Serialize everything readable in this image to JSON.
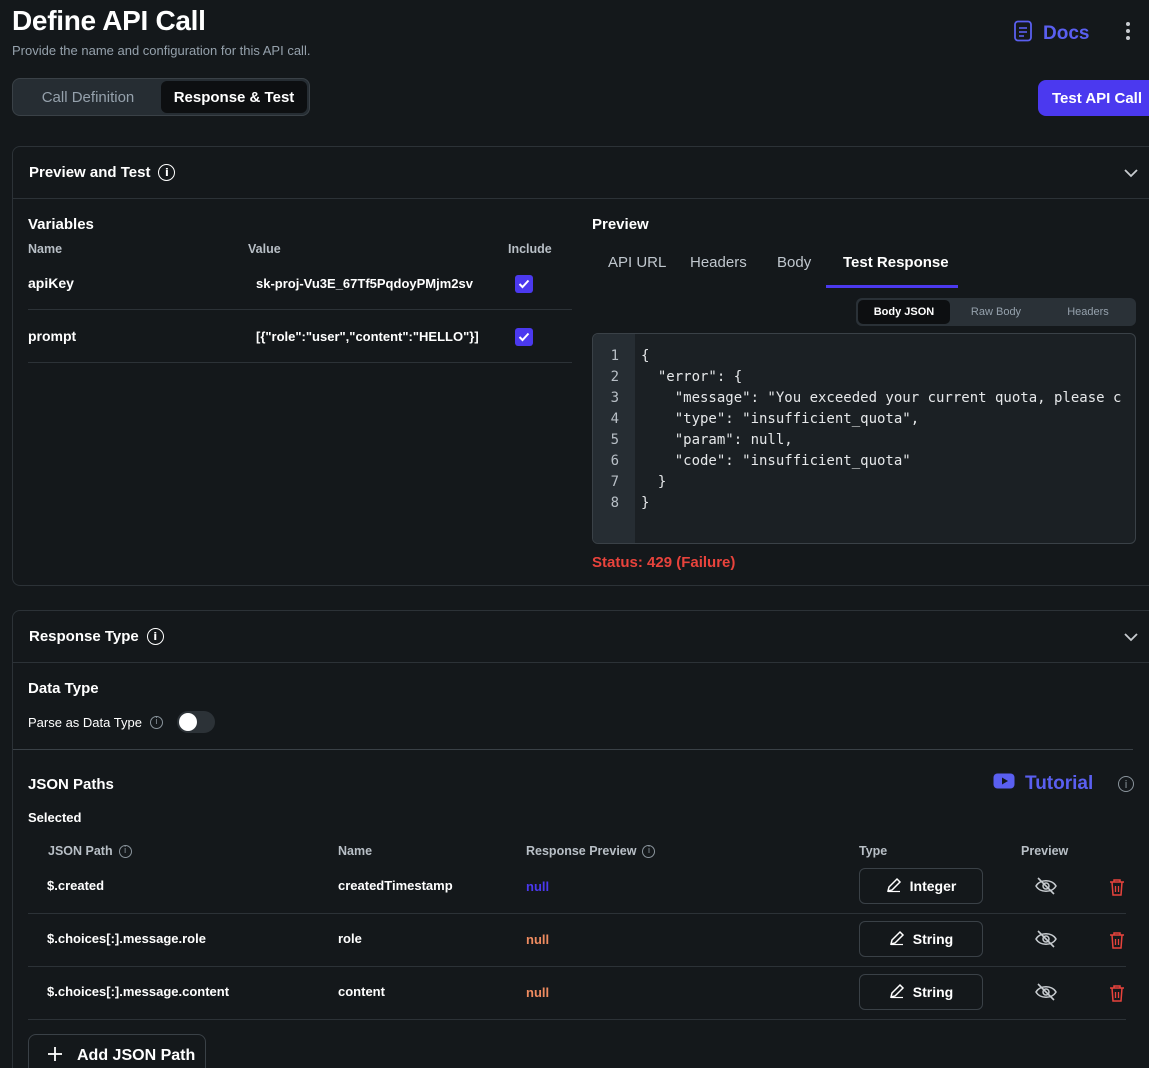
{
  "header": {
    "title": "Define API Call",
    "subtitle": "Provide the name and configuration for this API call.",
    "docs_label": "Docs"
  },
  "tabs": [
    {
      "label": "Call Definition",
      "active": false
    },
    {
      "label": "Response & Test",
      "active": true
    }
  ],
  "test_button_label": "Test API Call",
  "preview_section": {
    "title": "Preview and Test",
    "variables": {
      "title": "Variables",
      "columns": [
        "Name",
        "Value",
        "Include"
      ],
      "rows": [
        {
          "name": "apiKey",
          "value": "sk-proj-Vu3E_67Tf5PqdoyPMjm2sv",
          "include": true
        },
        {
          "name": "prompt",
          "value": "[{\"role\":\"user\",\"content\":\"HELLO\"}]",
          "include": true
        }
      ]
    },
    "preview": {
      "title": "Preview",
      "tabs": [
        "API URL",
        "Headers",
        "Body",
        "Test Response"
      ],
      "active_tab": "Test Response",
      "subtabs": [
        "Body JSON",
        "Raw Body",
        "Headers"
      ],
      "active_subtab": "Body JSON",
      "code_lines": [
        "{",
        "  \"error\": {",
        "    \"message\": \"You exceeded your current quota, please c",
        "    \"type\": \"insufficient_quota\",",
        "    \"param\": null,",
        "    \"code\": \"insufficient_quota\"",
        "  }",
        "}"
      ],
      "line_numbers": [
        "1",
        "2",
        "3",
        "4",
        "5",
        "6",
        "7",
        "8"
      ],
      "status": "Status:  429 (Failure)"
    }
  },
  "response_section": {
    "title": "Response Type",
    "data_type_title": "Data Type",
    "parse_label": "Parse as Data Type",
    "parse_enabled": false,
    "json_paths_title": "JSON Paths",
    "tutorial_label": "Tutorial",
    "selected_label": "Selected",
    "columns": [
      "JSON Path",
      "Name",
      "Response Preview",
      "Type",
      "Preview"
    ],
    "rows": [
      {
        "path": "$.created",
        "name": "createdTimestamp",
        "preview": "null",
        "preview_color": "#4b39ef",
        "type": "Integer"
      },
      {
        "path": "$.choices[:].message.role",
        "name": "role",
        "preview": "null",
        "preview_color": "#ee8b60",
        "type": "String"
      },
      {
        "path": "$.choices[:].message.content",
        "name": "content",
        "preview": "null",
        "preview_color": "#ee8b60",
        "type": "String"
      }
    ],
    "add_button_label": "Add JSON Path"
  },
  "colors": {
    "accent": "#4b39ef",
    "accent_text": "#5a5ff0",
    "error": "#e8433c",
    "danger_icon": "#e8433c"
  }
}
